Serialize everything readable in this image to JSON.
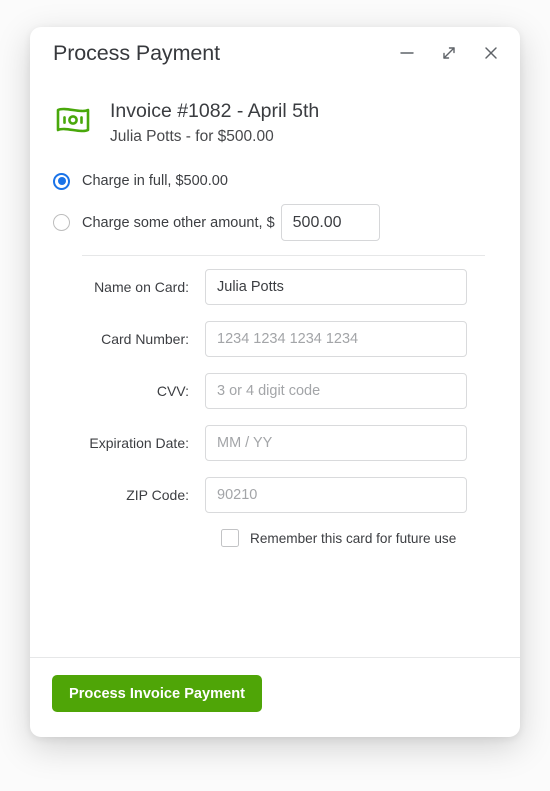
{
  "window": {
    "title": "Process Payment",
    "controls": [
      {
        "name": "minimize-button",
        "glyph": "minimize-icon"
      },
      {
        "name": "expand-button",
        "glyph": "expand-icon"
      },
      {
        "name": "close-button",
        "glyph": "close-icon"
      }
    ]
  },
  "invoice": {
    "icon": "banknote-icon",
    "heading": "Invoice #1082 - April 5th",
    "subheading": "Julia Potts - for $500.00"
  },
  "charge_options": {
    "full": {
      "label": "Charge in full, $500.00",
      "selected": true
    },
    "other": {
      "label": "Charge some other amount, $",
      "selected": false,
      "amount_value": "500.00"
    }
  },
  "form": {
    "fields": [
      {
        "name": "name-on-card",
        "label": "Name on Card:",
        "value": "Julia Potts",
        "placeholder": ""
      },
      {
        "name": "card-number",
        "label": "Card Number:",
        "value": "",
        "placeholder": "1234 1234 1234 1234"
      },
      {
        "name": "cvv",
        "label": "CVV:",
        "value": "",
        "placeholder": "3 or 4 digit code"
      },
      {
        "name": "expiration-date",
        "label": "Expiration Date:",
        "value": "",
        "placeholder": "MM / YY"
      },
      {
        "name": "zip-code",
        "label": "ZIP Code:",
        "value": "",
        "placeholder": "90210"
      }
    ],
    "remember_card": {
      "label": "Remember this card for future use",
      "checked": false
    }
  },
  "footer": {
    "submit_label": "Process Invoice Payment"
  },
  "colors": {
    "accent_green": "#4fa507",
    "icon_green": "#49a80b",
    "radio_blue": "#1a73e8",
    "text_primary": "#3c3e42",
    "placeholder": "#a3a5a8",
    "border": "#d9dadc",
    "page_background": "#fbfbfb"
  }
}
